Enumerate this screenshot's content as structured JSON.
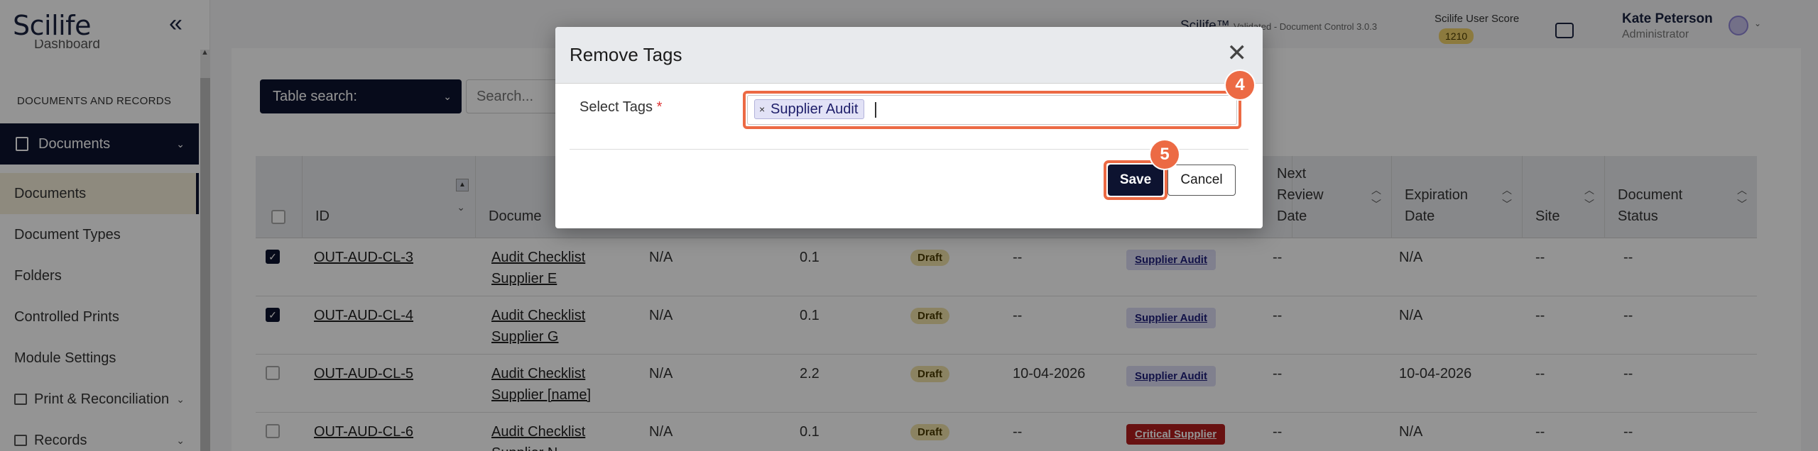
{
  "sidebar": {
    "logo": "Scilife",
    "collapse_icon": "«",
    "partial_item": "Dashboard",
    "section_header": "DOCUMENTS AND RECORDS",
    "documents_group": "Documents",
    "items": [
      {
        "label": "Documents"
      },
      {
        "label": "Document Types"
      },
      {
        "label": "Folders"
      },
      {
        "label": "Controlled Prints"
      },
      {
        "label": "Module Settings"
      },
      {
        "label": "Print & Reconciliation"
      },
      {
        "label": "Records"
      }
    ]
  },
  "header": {
    "app_name": "Scilife™",
    "app_version": "Validated - Document Control 3.0.3",
    "score_label": "Scilife User Score",
    "score_value": "1210",
    "user_name": "Kate Peterson",
    "user_role": "Administrator"
  },
  "toolbar": {
    "table_search_label": "Table search:",
    "search_placeholder": "Search..."
  },
  "table": {
    "columns": {
      "id": "ID",
      "document": "Docume",
      "next_review_1": "Next",
      "next_review_2": "Review",
      "next_review_3": "Date",
      "expiration_1": "Expiration",
      "expiration_2": "Date",
      "site": "Site",
      "status_1": "Document",
      "status_2": "Status"
    },
    "rows": [
      {
        "id": "OUT-AUD-CL-3",
        "title_1": "Audit Checklist",
        "title_2": "Supplier E",
        "col3": "N/A",
        "version": "0.1",
        "state": "Draft",
        "date": "--",
        "tag": "Supplier Audit",
        "next_review": "--",
        "expiration": "N/A",
        "site": "--",
        "status": "--"
      },
      {
        "id": "OUT-AUD-CL-4",
        "title_1": "Audit Checklist",
        "title_2": "Supplier G",
        "col3": "N/A",
        "version": "0.1",
        "state": "Draft",
        "date": "--",
        "tag": "Supplier Audit",
        "next_review": "--",
        "expiration": "N/A",
        "site": "--",
        "status": "--"
      },
      {
        "id": "OUT-AUD-CL-5",
        "title_1": "Audit Checklist",
        "title_2": "Supplier [name]",
        "col3": "N/A",
        "version": "2.2",
        "state": "Draft",
        "date": "10-04-2026",
        "tag": "Supplier Audit",
        "next_review": "--",
        "expiration": "10-04-2026",
        "site": "--",
        "status": "--"
      },
      {
        "id": "OUT-AUD-CL-6",
        "title_1": "Audit Checklist",
        "title_2": "Supplier N",
        "col3": "N/A",
        "version": "0.1",
        "state": "Draft",
        "date": "--",
        "tag": "Critical Supplier",
        "next_review": "--",
        "expiration": "N/A",
        "site": "--",
        "status": "--"
      }
    ]
  },
  "modal": {
    "title": "Remove Tags",
    "field_label": "Select Tags",
    "required_mark": "*",
    "selected_tag": "Supplier Audit",
    "chip_remove": "×",
    "save_label": "Save",
    "cancel_label": "Cancel",
    "close_glyph": "✕"
  },
  "steps": {
    "tags_step": "4",
    "save_step": "5"
  },
  "colors": {
    "navy": "#0d1330",
    "highlight": "#ec6a44",
    "draft": "#efe2a9",
    "critical": "#b41e1e"
  }
}
